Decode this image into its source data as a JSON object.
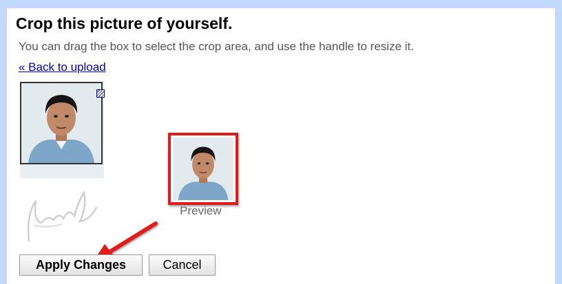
{
  "header": {
    "title": "Crop this picture of yourself.",
    "subtitle": "You can drag the box to select the crop area, and use the handle to resize it."
  },
  "nav": {
    "back_link": "« Back to upload"
  },
  "preview": {
    "label": "Preview"
  },
  "buttons": {
    "apply_label": "Apply Changes",
    "cancel_label": "Cancel"
  },
  "colors": {
    "page_background": "#c3d9ff",
    "link": "#0000cc",
    "highlight_red": "#e01b1b"
  },
  "icons": {
    "resize_handle": "resize-handle-icon",
    "annotation_arrow": "red-arrow-icon"
  }
}
